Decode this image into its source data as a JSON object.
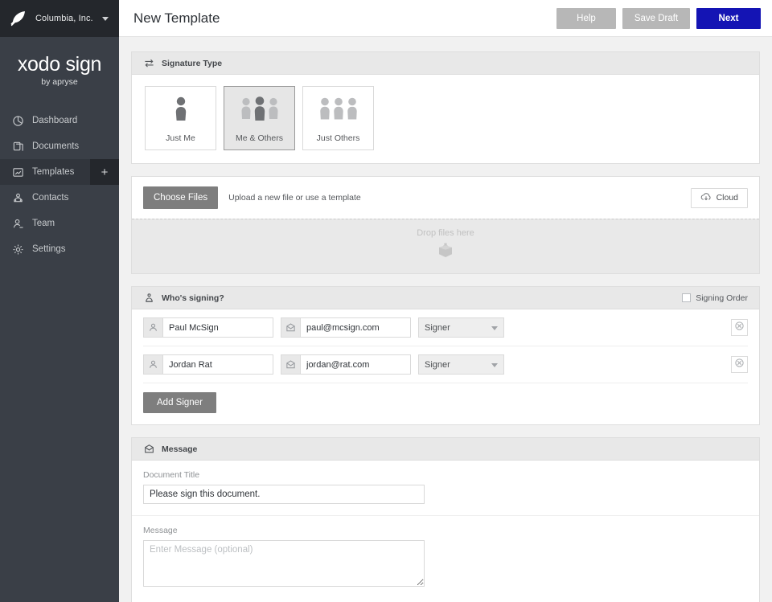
{
  "sidebar": {
    "org": {
      "name": "Columbia, Inc.",
      "logo_icon": "feather-logo-icon",
      "caret_icon": "chevron-down-icon"
    },
    "brand": {
      "title": "xodo sign",
      "subtitle": "by apryse"
    },
    "items": [
      {
        "label": "Dashboard",
        "icon": "pie-chart-icon",
        "active": false
      },
      {
        "label": "Documents",
        "icon": "documents-icon",
        "active": false
      },
      {
        "label": "Templates",
        "icon": "template-icon",
        "active": true,
        "plus": "+"
      },
      {
        "label": "Contacts",
        "icon": "contacts-icon",
        "active": false
      },
      {
        "label": "Team",
        "icon": "team-icon",
        "active": false
      },
      {
        "label": "Settings",
        "icon": "gear-icon",
        "active": false
      }
    ]
  },
  "topbar": {
    "title": "New Template",
    "help_label": "Help",
    "save_draft_label": "Save Draft",
    "next_label": "Next",
    "next_color": "#1414b4",
    "grey_button_color": "#b7b7b7"
  },
  "signature_type": {
    "header": "Signature Type",
    "header_icon": "swap-arrows-icon",
    "options": [
      {
        "label": "Just Me",
        "icon": "single-person-icon",
        "selected": false
      },
      {
        "label": "Me & Others",
        "icon": "three-people-highlight-middle-icon",
        "selected": true
      },
      {
        "label": "Just Others",
        "icon": "three-people-icon",
        "selected": false
      }
    ]
  },
  "upload": {
    "choose_files_label": "Choose Files",
    "hint": "Upload a new file or use a template",
    "cloud_label": "Cloud",
    "cloud_icon": "cloud-download-icon",
    "dropzone_text": "Drop files here",
    "dropzone_icon": "box-download-icon"
  },
  "signers": {
    "header": "Who's signing?",
    "header_icon": "signer-person-icon",
    "signing_order_label": "Signing Order",
    "signing_order_checked": false,
    "name_icon": "person-icon",
    "email_icon": "envelope-icon",
    "role_icon": "clipboard-icon",
    "delete_icon": "remove-circle-icon",
    "role_options": [
      "Signer"
    ],
    "rows": [
      {
        "name": "Paul McSign",
        "email": "paul@mcsign.com",
        "role": "Signer"
      },
      {
        "name": "Jordan Rat",
        "email": "jordan@rat.com",
        "role": "Signer"
      }
    ],
    "add_signer_label": "Add Signer"
  },
  "message": {
    "header": "Message",
    "header_icon": "envelope-icon",
    "document_title_label": "Document Title",
    "document_title_value": "Please sign this document.",
    "document_title_placeholder": "Document Title",
    "message_label": "Message",
    "message_value": "",
    "message_placeholder": "Enter Message (optional)"
  }
}
